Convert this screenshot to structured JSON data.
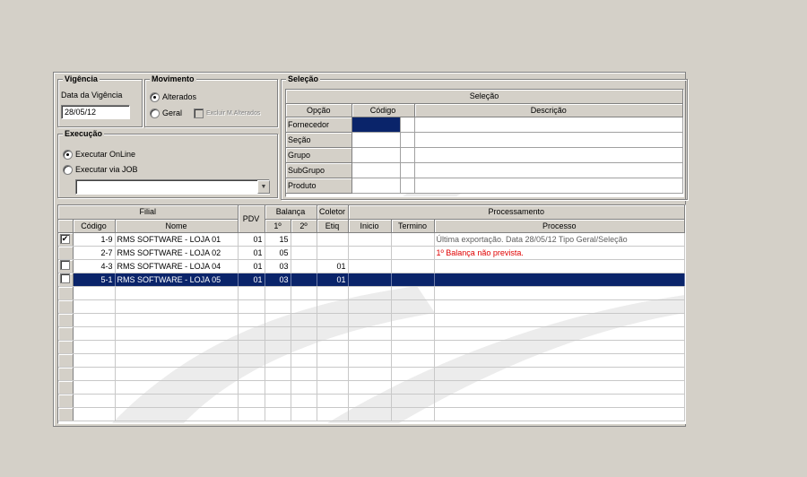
{
  "vigencia": {
    "title": "Vigência",
    "label": "Data da Vigência",
    "value": "28/05/12"
  },
  "movimento": {
    "title": "Movimento",
    "opt_alterados": "Alterados",
    "opt_geral": "Geral",
    "chk_excluir": "Excluir M.Alterados"
  },
  "execucao": {
    "title": "Execução",
    "opt_online": "Executar OnLine",
    "opt_job": "Executar via JOB",
    "job_value": ""
  },
  "selecao": {
    "title": "Seleção",
    "grid_title": "Seleção",
    "headers": {
      "opcao": "Opção",
      "codigo": "Código",
      "descricao": "Descrição"
    },
    "rows": [
      "Fornecedor",
      "Seção",
      "Grupo",
      "SubGrupo",
      "Produto"
    ]
  },
  "grid": {
    "groups": {
      "filial": "Filial",
      "pdv": "PDV",
      "balanca": "Balança",
      "coletor": "Coletor",
      "processamento": "Processamento"
    },
    "headers": {
      "codigo": "Código",
      "nome": "Nome",
      "b1": "1º",
      "b2": "2º",
      "etiq": "Etiq",
      "inicio": "Inicio",
      "termino": "Termino",
      "processo": "Processo"
    },
    "rows": [
      {
        "checked": "✔",
        "codigo": "1-9",
        "nome": "RMS SOFTWARE - LOJA 01",
        "pdv": "01",
        "b1": "15",
        "b2": "",
        "etiq": "",
        "inicio": "",
        "termino": "",
        "processo": "Última exportação. Data 28/05/12 Tipo Geral/Seleção"
      },
      {
        "checked": "",
        "codigo": "2-7",
        "nome": "RMS SOFTWARE - LOJA 02",
        "pdv": "01",
        "b1": "05",
        "b2": "",
        "etiq": "",
        "inicio": "",
        "termino": "",
        "processo": "1º Balança não prevista."
      },
      {
        "checked": "",
        "codigo": "4-3",
        "nome": "RMS SOFTWARE - LOJA 04",
        "pdv": "01",
        "b1": "03",
        "b2": "",
        "etiq": "01",
        "inicio": "",
        "termino": "",
        "processo": ""
      },
      {
        "checked": "",
        "codigo": "5-1",
        "nome": "RMS SOFTWARE - LOJA 05",
        "pdv": "01",
        "b1": "03",
        "b2": "",
        "etiq": "01",
        "inicio": "",
        "termino": "",
        "processo": ""
      }
    ]
  },
  "colors": {
    "selection": "#0a246a",
    "error_text": "#e00000",
    "face": "#d4d0c8"
  }
}
